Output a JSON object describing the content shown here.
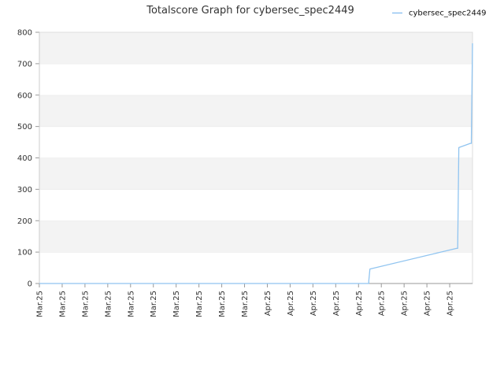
{
  "chart_data": {
    "type": "line",
    "title": "Totalscore Graph for cybersec_spec2449",
    "xlabel": "",
    "ylabel": "",
    "x_tick_labels": [
      "Mar.25",
      "Mar.25",
      "Mar.25",
      "Mar.25",
      "Mar.25",
      "Mar.25",
      "Mar.25",
      "Mar.25",
      "Mar.25",
      "Mar.25",
      "Apr.25",
      "Apr.25",
      "Apr.25",
      "Apr.25",
      "Apr.25",
      "Apr.25",
      "Apr.25",
      "Apr.25",
      "Apr.25"
    ],
    "y_ticks": [
      0,
      100,
      200,
      300,
      400,
      500,
      600,
      700,
      800
    ],
    "ylim": [
      0,
      800
    ],
    "x_range_index": [
      0,
      19
    ],
    "grid": "horizontal bands",
    "legend_position": "top-right",
    "series": [
      {
        "name": "cybersec_spec2449",
        "color": "#90c4f0",
        "points": [
          [
            0,
            0
          ],
          [
            14.45,
            0
          ],
          [
            14.45,
            8
          ],
          [
            14.5,
            46
          ],
          [
            18.3,
            112
          ],
          [
            18.35,
            112
          ],
          [
            18.4,
            433
          ],
          [
            18.9,
            446
          ],
          [
            18.95,
            446
          ],
          [
            18.95,
            460
          ],
          [
            19.0,
            765
          ]
        ]
      }
    ]
  }
}
